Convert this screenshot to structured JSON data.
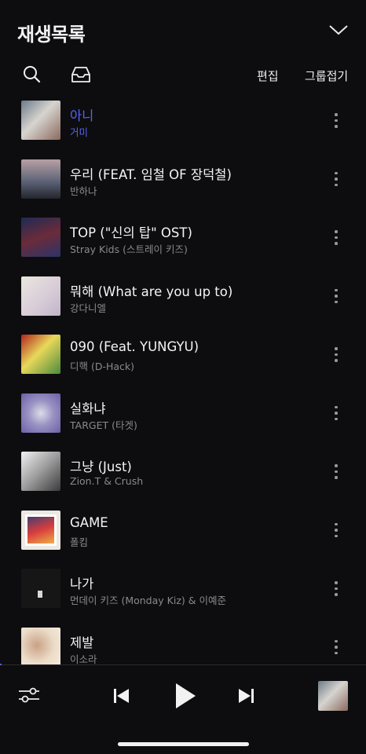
{
  "header": {
    "title": "재생목록"
  },
  "toolbar": {
    "edit_label": "편집",
    "collapse_groups_label": "그룹접기"
  },
  "tracks": [
    {
      "title": "아니",
      "artist": "거미",
      "current": true
    },
    {
      "title": "우리 (FEAT. 임철 OF 장덕철)",
      "artist": "반하나"
    },
    {
      "title": "TOP (\"신의 탑\" OST)",
      "artist": "Stray Kids (스트레이 키즈)"
    },
    {
      "title": "뭐해 (What are you up to)",
      "artist": "강다니엘"
    },
    {
      "title": "090 (Feat. YUNGYU)",
      "artist": "디핵 (D-Hack)"
    },
    {
      "title": "실화냐",
      "artist": "TARGET (타겟)"
    },
    {
      "title": "그냥 (Just)",
      "artist": "Zion.T & Crush"
    },
    {
      "title": "GAME",
      "artist": "폴킴"
    },
    {
      "title": "나가",
      "artist": "먼데이 키즈 (Monday Kiz) & 이예준"
    },
    {
      "title": "제발",
      "artist": "이소라"
    }
  ],
  "player": {
    "state": "paused",
    "progress": 0.004
  },
  "colors": {
    "accent": "#5562ff",
    "background": "#0d0d0f",
    "secondary_text": "#8a8a8a"
  },
  "icons": [
    "search-icon",
    "inbox-icon",
    "chevron-down-icon",
    "more-vertical-icon",
    "equalizer-icon",
    "previous-icon",
    "play-icon",
    "next-icon"
  ]
}
